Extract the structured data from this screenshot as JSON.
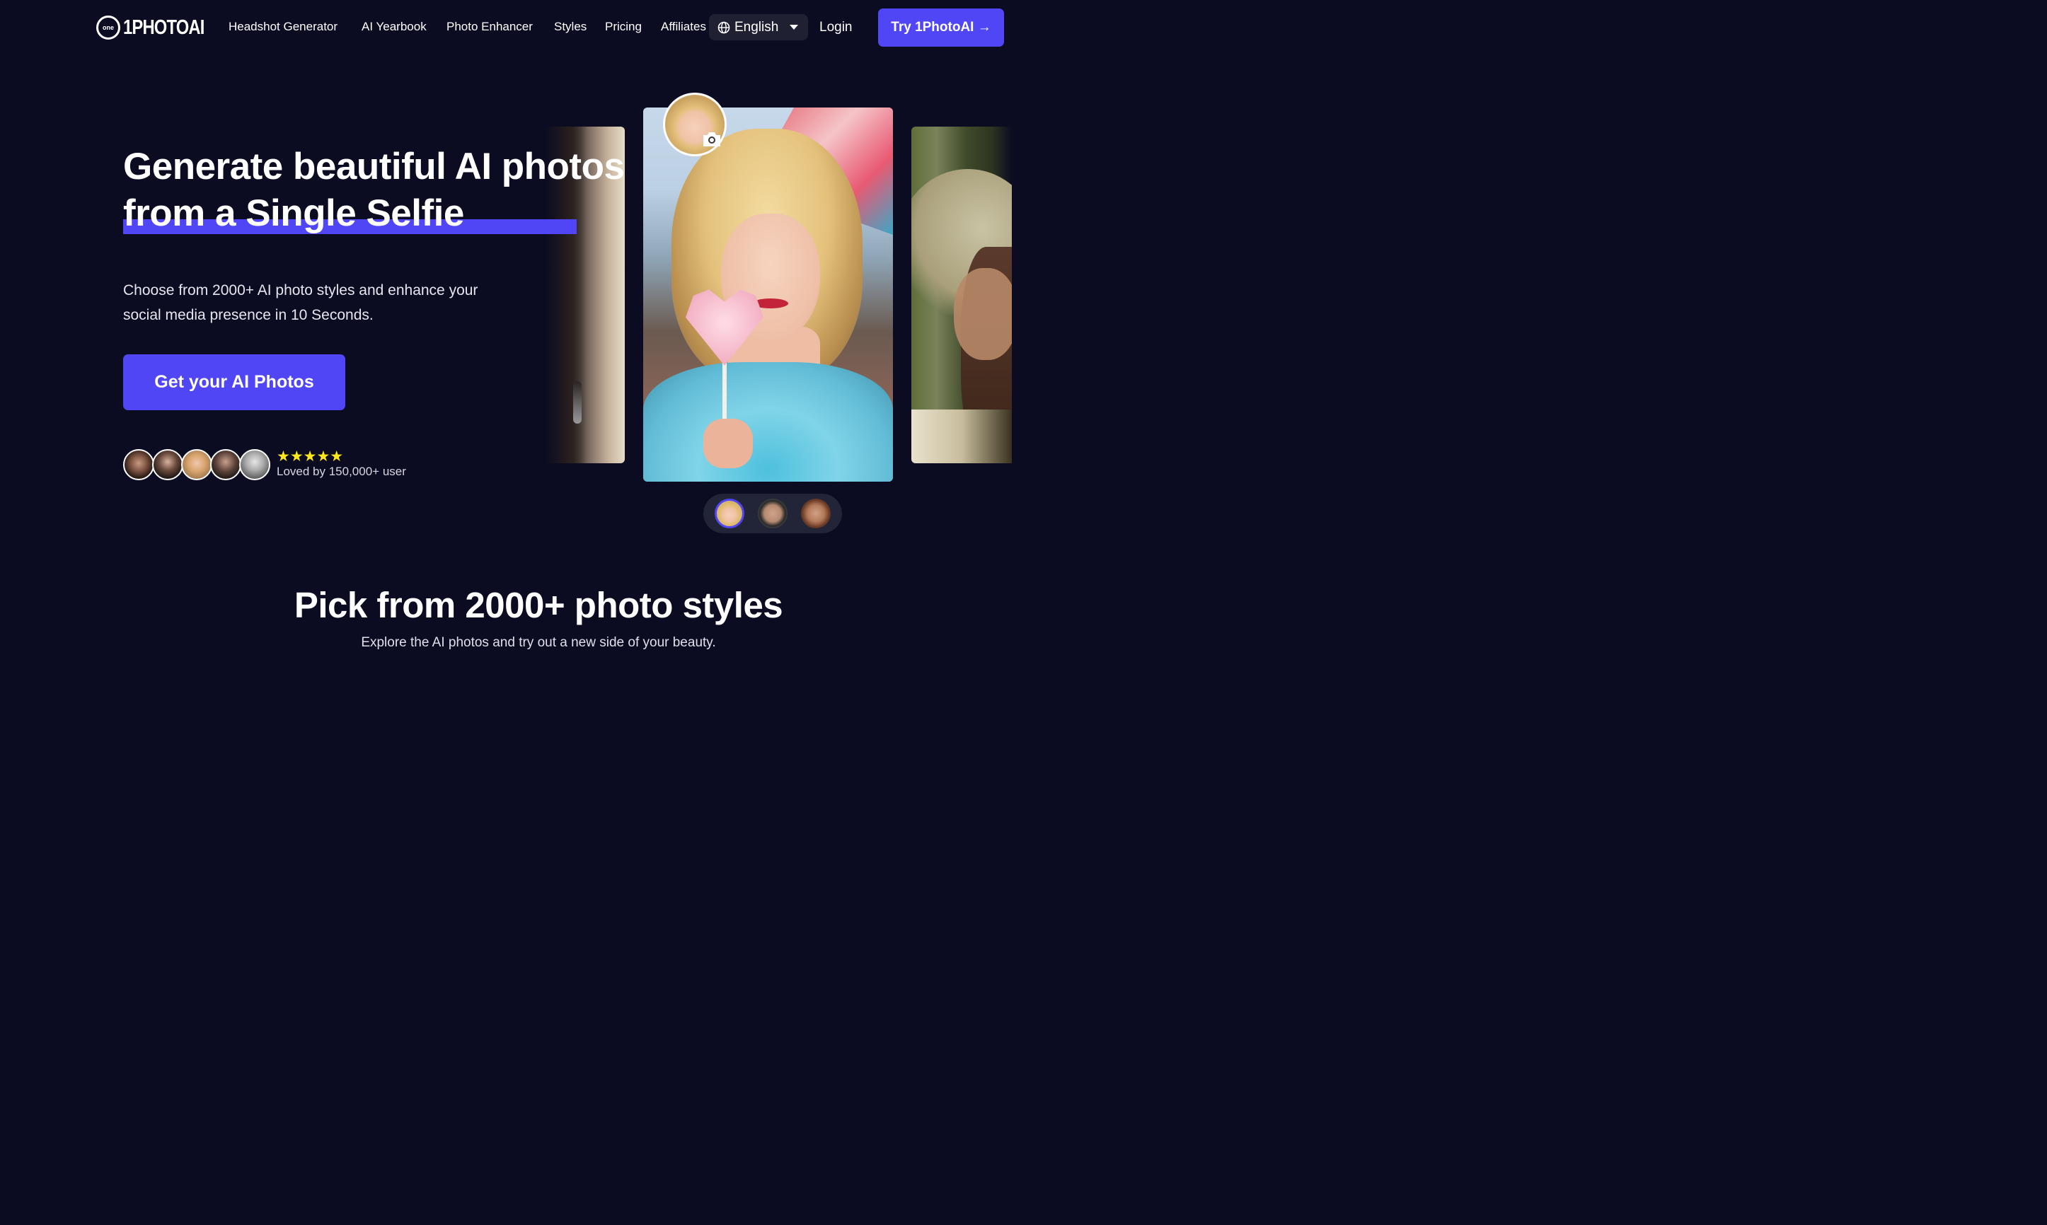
{
  "nav": {
    "logo_text": "1PHOTOAI",
    "logo_badge": "one",
    "links": [
      "Headshot Generator",
      "AI Yearbook",
      "Photo Enhancer",
      "Styles",
      "Pricing",
      "Affiliates"
    ],
    "language": "English",
    "login": "Login",
    "try_button": "Try 1PhotoAI →"
  },
  "hero": {
    "title_line1": "Generate beautiful AI photos",
    "title_line2": "from a Single Selfie",
    "subtitle": "Choose from 2000+ AI photo styles and enhance your social media presence in 10 Seconds.",
    "cta": "Get your AI Photos",
    "rating_stars": "★★★★★",
    "rating_value": 5,
    "social_proof": "Loved by 150,000+ user"
  },
  "styles_section": {
    "title": "Pick from 2000+ photo styles",
    "subtitle": "Explore the AI photos and try out a new side of your beauty."
  },
  "colors": {
    "background": "#0b0b22",
    "accent": "#5046f5",
    "star": "#ffe81a"
  },
  "icons": [
    "globe-icon",
    "chevron-down-icon",
    "arrow-right-icon",
    "camera-icon",
    "star-icon"
  ]
}
